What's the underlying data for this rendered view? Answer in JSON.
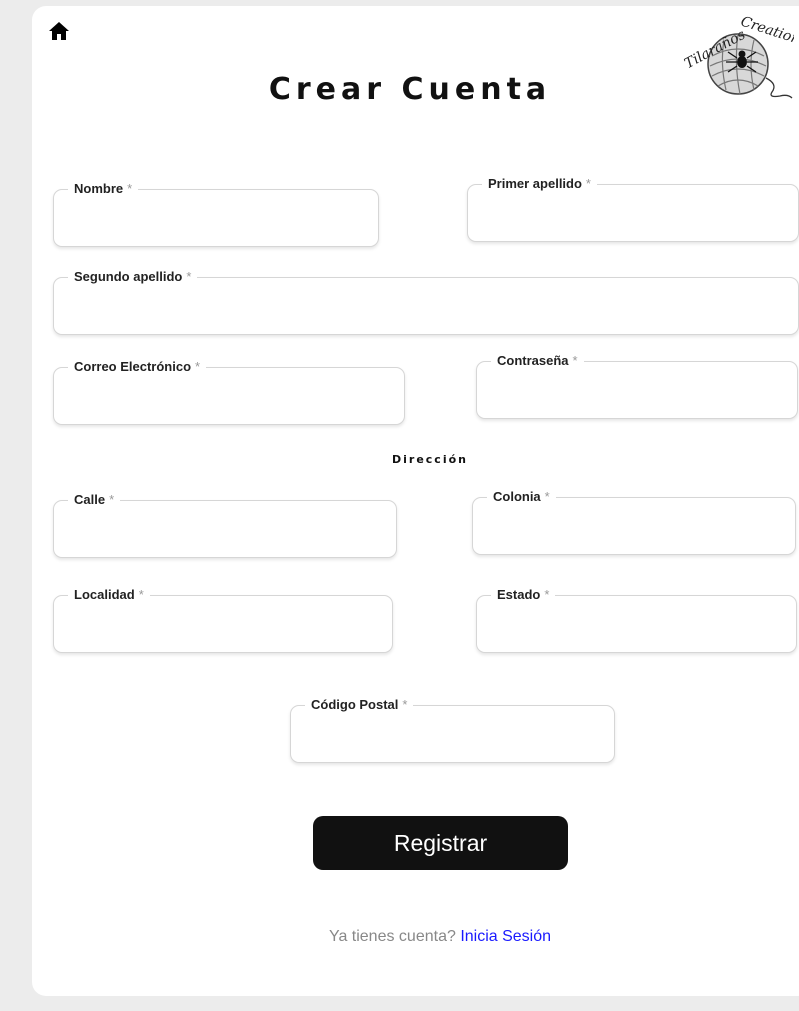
{
  "header": {
    "title": "Crear Cuenta",
    "home_icon": "home-icon",
    "logo_text": "Tilaraños Creations"
  },
  "form": {
    "fields": {
      "nombre": {
        "label": "Nombre",
        "required_mark": "*",
        "value": ""
      },
      "primer_apellido": {
        "label": "Primer apellido",
        "required_mark": "*",
        "value": ""
      },
      "segundo_apellido": {
        "label": "Segundo apellido",
        "required_mark": "*",
        "value": ""
      },
      "correo": {
        "label": "Correo Electrónico",
        "required_mark": "*",
        "value": ""
      },
      "contrasena": {
        "label": "Contraseña",
        "required_mark": "*",
        "value": ""
      },
      "calle": {
        "label": "Calle",
        "required_mark": "*",
        "value": ""
      },
      "colonia": {
        "label": "Colonia",
        "required_mark": "*",
        "value": ""
      },
      "localidad": {
        "label": "Localidad",
        "required_mark": "*",
        "value": ""
      },
      "estado": {
        "label": "Estado",
        "required_mark": "*",
        "value": ""
      },
      "codigo_postal": {
        "label": "Código Postal",
        "required_mark": "*",
        "value": ""
      }
    },
    "section_address": "Dirección",
    "submit_label": "Registrar"
  },
  "footer": {
    "prompt": "Ya tienes cuenta?",
    "login_link": "Inicia Sesión"
  },
  "colors": {
    "background": "#ececec",
    "card": "#ffffff",
    "button": "#111111",
    "link": "#1a1aff",
    "placeholder_text": "#888888"
  }
}
